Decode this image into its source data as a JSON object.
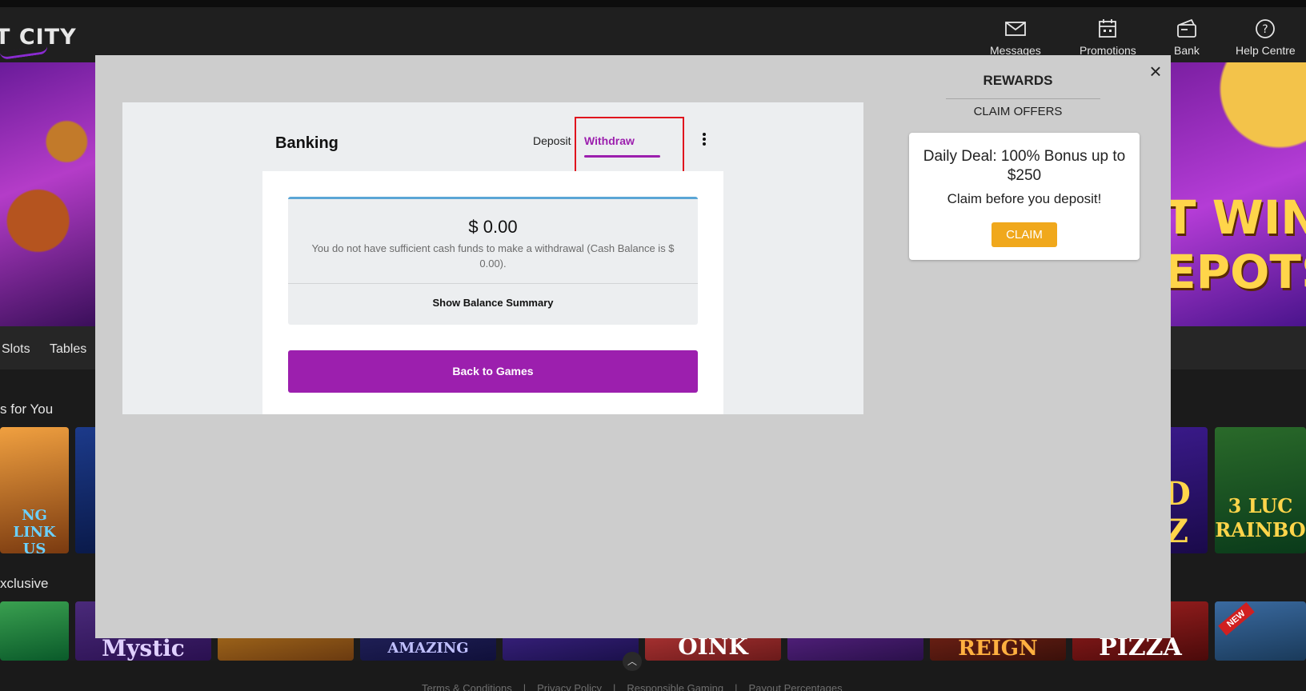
{
  "header": {
    "logo_text": "T CITY",
    "nav": [
      {
        "label": "Messages",
        "icon": "envelope-icon"
      },
      {
        "label": "Promotions",
        "icon": "calendar-icon"
      },
      {
        "label": "Bank",
        "icon": "wallet-icon"
      },
      {
        "label": "Help Centre",
        "icon": "question-circle-icon"
      }
    ]
  },
  "background": {
    "hero_right_text": "T WIN\nEPOTS",
    "categories": [
      "Slots",
      "Tables"
    ],
    "sections": [
      "s for You",
      "xclusive"
    ],
    "tiles_row1": [
      "NG LINK US",
      "D Z",
      "3 LUC RAINBO"
    ],
    "tiles_row2": [
      "Mystic",
      "AMAZING",
      "OINK",
      "REIGN",
      "PIZZA",
      "NEW"
    ],
    "footer_links": [
      "Terms & Conditions",
      "Privacy Policy",
      "Responsible Gaming",
      "Payout Percentages"
    ],
    "footer_sep": "|"
  },
  "modal": {
    "close_label": "×",
    "banking": {
      "title": "Banking",
      "tabs": {
        "deposit": "Deposit",
        "withdraw": "Withdraw",
        "active": "withdraw"
      },
      "balance_amount": "$ 0.00",
      "balance_message": "You do not have sufficient cash funds to make a withdrawal (Cash Balance is $ 0.00).",
      "show_summary_label": "Show Balance Summary",
      "back_button_label": "Back to Games"
    },
    "rewards": {
      "title": "REWARDS",
      "subtitle": "CLAIM OFFERS",
      "offer": {
        "title": "Daily Deal: 100% Bonus up to $250",
        "subtitle": "Claim before you deposit!",
        "button_label": "CLAIM"
      }
    }
  },
  "colors": {
    "accent_purple": "#9c1fae",
    "claim_orange": "#f0a81c",
    "highlight_red": "#e0141e",
    "balance_border_blue": "#5aa6d6"
  }
}
